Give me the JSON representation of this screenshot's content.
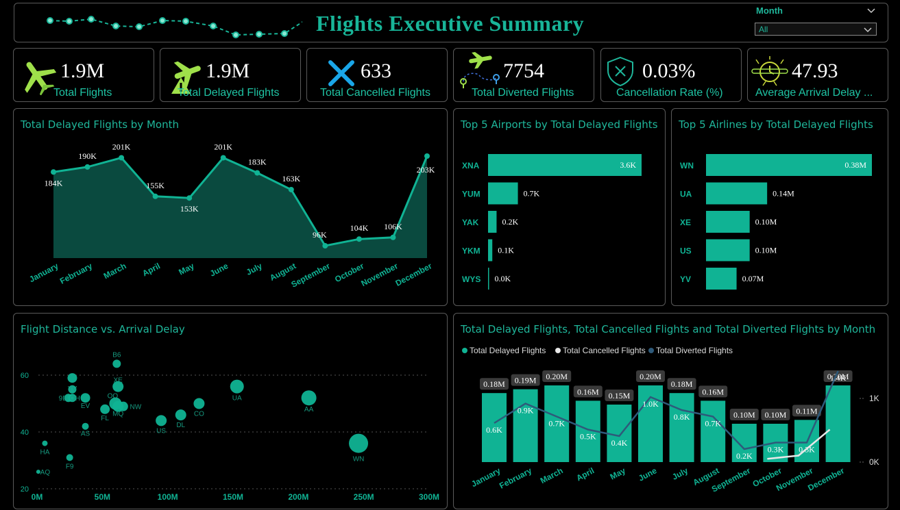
{
  "header": {
    "title": "Flights Executive Summary"
  },
  "slicer": {
    "label": "Month",
    "value": "All"
  },
  "kpis": [
    {
      "value": "1.9M",
      "label": "Total Flights",
      "icon": "airplane-icon"
    },
    {
      "value": "1.9M",
      "label": "Total Delayed Flights",
      "icon": "delayed-plane-icon"
    },
    {
      "value": "633",
      "label": "Total Cancelled Flights",
      "icon": "cancel-x-icon"
    },
    {
      "value": "7754",
      "label": "Total Diverted Flights",
      "icon": "route-plane-icon"
    },
    {
      "value": "0.03%",
      "label": "Cancellation Rate (%)",
      "icon": "shield-x-icon"
    },
    {
      "value": "47.93",
      "label": "Average Arrival Delay ...",
      "icon": "clock-airplane-icon"
    }
  ],
  "colors": {
    "accent": "#10b394",
    "area_fill": "#0a4a3f",
    "diverted_line": "#2e5a7a",
    "cancelled_line": "#e8e8e8",
    "border": "#5a5a5a"
  },
  "chart_data": [
    {
      "id": "delayed-by-month",
      "type": "area",
      "title": "Total Delayed Flights by Month",
      "categories": [
        "January",
        "February",
        "March",
        "April",
        "May",
        "June",
        "July",
        "August",
        "September",
        "October",
        "November",
        "December"
      ],
      "values": [
        184,
        190,
        201,
        155,
        153,
        201,
        183,
        163,
        96,
        104,
        106,
        203
      ],
      "value_unit": "K",
      "labels": [
        "184K",
        "190K",
        "201K",
        "155K",
        "153K",
        "201K",
        "183K",
        "163K",
        "96K",
        "104K",
        "106K",
        "203K"
      ],
      "ylim": [
        0,
        215
      ]
    },
    {
      "id": "top-airports",
      "type": "bar",
      "orientation": "horizontal",
      "title": "Top 5 Airports by Total Delayed Flights",
      "categories": [
        "XNA",
        "YUM",
        "YAK",
        "YKM",
        "WYS"
      ],
      "values": [
        3.6,
        0.7,
        0.2,
        0.1,
        0.0
      ],
      "labels": [
        "3.6K",
        "0.7K",
        "0.2K",
        "0.1K",
        "0.0K"
      ]
    },
    {
      "id": "top-airlines",
      "type": "bar",
      "orientation": "horizontal",
      "title": "Top 5 Airlines by Total Delayed Flights",
      "categories": [
        "WN",
        "UA",
        "XE",
        "US",
        "YV"
      ],
      "values": [
        0.38,
        0.14,
        0.1,
        0.1,
        0.07
      ],
      "labels": [
        "0.38M",
        "0.14M",
        "0.10M",
        "0.10M",
        "0.07M"
      ]
    },
    {
      "id": "distance-vs-delay",
      "type": "scatter",
      "title": "Flight Distance vs. Arrival Delay",
      "x_ticks": [
        "0M",
        "50M",
        "100M",
        "150M",
        "200M",
        "250M",
        "300M"
      ],
      "y_ticks": [
        "20",
        "40",
        "60"
      ],
      "xlim": [
        0,
        300
      ],
      "ylim": [
        20,
        70
      ],
      "points": [
        {
          "label": "B6",
          "x": 61,
          "y": 64,
          "size": 6
        },
        {
          "label": "XE",
          "x": 62,
          "y": 56,
          "size": 8
        },
        {
          "label": "OO",
          "x": 60,
          "y": 50,
          "size": 9
        },
        {
          "label": "MQ",
          "x": 62,
          "y": 49,
          "size": 8
        },
        {
          "label": "NW",
          "x": 66,
          "y": 49,
          "size": 7
        },
        {
          "label": "FL",
          "x": 52,
          "y": 48,
          "size": 7
        },
        {
          "label": "EV",
          "x": 37,
          "y": 52,
          "size": 7
        },
        {
          "label": "AS",
          "x": 37,
          "y": 42,
          "size": 5
        },
        {
          "label": "9E",
          "x": 24,
          "y": 52,
          "size": 6
        },
        {
          "label": "OH",
          "x": 27,
          "y": 52,
          "size": 6
        },
        {
          "label": "YV",
          "x": 27,
          "y": 55,
          "size": 6
        },
        {
          "label": "",
          "x": 27,
          "y": 59,
          "size": 7
        },
        {
          "label": "US",
          "x": 95,
          "y": 44,
          "size": 8
        },
        {
          "label": "DL",
          "x": 110,
          "y": 46,
          "size": 8
        },
        {
          "label": "CO",
          "x": 124,
          "y": 50,
          "size": 8
        },
        {
          "label": "UA",
          "x": 153,
          "y": 56,
          "size": 10
        },
        {
          "label": "AA",
          "x": 208,
          "y": 52,
          "size": 11
        },
        {
          "label": "WN",
          "x": 246,
          "y": 36,
          "size": 14
        },
        {
          "label": "HA",
          "x": 6,
          "y": 36,
          "size": 4
        },
        {
          "label": "F9",
          "x": 25,
          "y": 31,
          "size": 5
        },
        {
          "label": "AQ",
          "x": 1,
          "y": 26,
          "size": 3
        }
      ]
    },
    {
      "id": "combo-by-month",
      "type": "bar",
      "title": "Total Delayed Flights, Total Cancelled Flights and Total Diverted Flights by Month",
      "categories": [
        "January",
        "February",
        "March",
        "April",
        "May",
        "June",
        "July",
        "August",
        "September",
        "October",
        "November",
        "December"
      ],
      "legend": [
        "Total Delayed Flights",
        "Total Cancelled Flights",
        "Total Diverted Flights"
      ],
      "series": [
        {
          "name": "Total Delayed Flights",
          "values": [
            0.18,
            0.19,
            0.2,
            0.16,
            0.15,
            0.2,
            0.18,
            0.16,
            0.1,
            0.1,
            0.11,
            0.2
          ],
          "labels": [
            "0.18M",
            "0.19M",
            "0.20M",
            "0.16M",
            "0.15M",
            "0.20M",
            "0.18M",
            "0.16M",
            "0.10M",
            "0.10M",
            "0.11M",
            "0.20M"
          ]
        },
        {
          "name": "Total Diverted Flights",
          "values": [
            0.6,
            0.9,
            0.7,
            0.5,
            0.4,
            1.0,
            0.8,
            0.7,
            0.2,
            0.3,
            0.3,
            1.4
          ],
          "labels": [
            "0.6K",
            "0.9K",
            "0.7K",
            "0.5K",
            "0.4K",
            "1.0K",
            "0.8K",
            "0.7K",
            "0.2K",
            "0.3K",
            "0.3K",
            "1.4K"
          ]
        },
        {
          "name": "Total Cancelled Flights",
          "values": [
            null,
            null,
            null,
            null,
            null,
            null,
            null,
            null,
            null,
            0.05,
            0.1,
            0.5
          ]
        }
      ],
      "y2_ticks": [
        "0K",
        "1K"
      ]
    }
  ]
}
